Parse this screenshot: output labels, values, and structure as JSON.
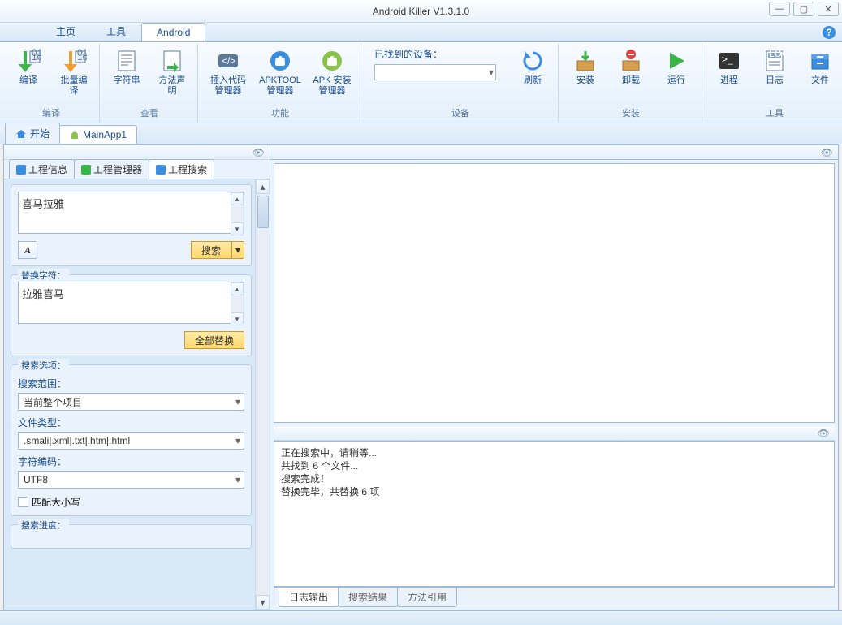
{
  "window": {
    "title": "Android Killer V1.3.1.0"
  },
  "menutabs": {
    "items": [
      "主页",
      "工具",
      "Android"
    ],
    "active": 2
  },
  "ribbon": {
    "groups": [
      {
        "label": "编译",
        "buttons": [
          {
            "name": "compile",
            "label": "编译",
            "icon": "arrow-down-binary",
            "color": "#3bb54a"
          },
          {
            "name": "batch-compile",
            "label": "批量编\n译",
            "icon": "arrow-down-binary",
            "color": "#f0a030"
          }
        ]
      },
      {
        "label": "查看",
        "buttons": [
          {
            "name": "strings",
            "label": "字符串",
            "icon": "page-lines",
            "color": "#5a7a9c"
          },
          {
            "name": "method-decl",
            "label": "方法声\n明",
            "icon": "page-arrow",
            "color": "#3bb54a"
          }
        ]
      },
      {
        "label": "功能",
        "buttons": [
          {
            "name": "insert-code",
            "label": "插入代码\n管理器",
            "icon": "code-brackets",
            "color": "#5a7a9c"
          },
          {
            "name": "apktool",
            "label": "APKTOOL\n管理器",
            "icon": "android-head",
            "color": "#3b8de0"
          },
          {
            "name": "apk-install",
            "label": "APK 安装\n管理器",
            "icon": "android-head",
            "color": "#8bc34a"
          }
        ]
      },
      {
        "label": "设备",
        "device_label": "已找到的设备：",
        "buttons": [
          {
            "name": "refresh",
            "label": "刷新",
            "icon": "refresh",
            "color": "#3b8de0"
          }
        ]
      },
      {
        "label": "安装",
        "buttons": [
          {
            "name": "install",
            "label": "安装",
            "icon": "box-down",
            "color": "#f0a030"
          },
          {
            "name": "uninstall",
            "label": "卸载",
            "icon": "box-up",
            "color": "#f0a030"
          },
          {
            "name": "run",
            "label": "运行",
            "icon": "play",
            "color": "#3bb54a"
          }
        ]
      },
      {
        "label": "工具",
        "buttons": [
          {
            "name": "process",
            "label": "进程",
            "icon": "terminal",
            "color": "#444"
          },
          {
            "name": "log",
            "label": "日志",
            "icon": "log-page",
            "color": "#5a7a9c"
          },
          {
            "name": "files",
            "label": "文件",
            "icon": "drawer",
            "color": "#3b8de0"
          }
        ]
      }
    ]
  },
  "doctabs": {
    "items": [
      {
        "name": "start",
        "label": "开始",
        "icon": "home"
      },
      {
        "name": "mainapp1",
        "label": "MainApp1",
        "icon": "android"
      }
    ],
    "active": 1
  },
  "left": {
    "tabs": {
      "items": [
        {
          "name": "project-info",
          "label": "工程信息",
          "color": "#3b8de0"
        },
        {
          "name": "project-manager",
          "label": "工程管理器",
          "color": "#3bb54a"
        },
        {
          "name": "project-search",
          "label": "工程搜索",
          "color": "#3b8de0"
        }
      ],
      "active": 2
    },
    "search": {
      "value": "喜马拉雅",
      "font_btn": "A",
      "search_btn": "搜索"
    },
    "replace": {
      "legend": "替换字符：",
      "value": "拉雅喜马",
      "replace_all_btn": "全部替换"
    },
    "options": {
      "legend": "搜索选项：",
      "scope_label": "搜索范围：",
      "scope_value": "当前整个项目",
      "filetype_label": "文件类型：",
      "filetype_value": ".smali|.xml|.txt|.htm|.html",
      "encoding_label": "字符编码：",
      "encoding_value": "UTF8",
      "match_case_label": "匹配大小写",
      "match_case_checked": false
    },
    "progress": {
      "legend": "搜索进度："
    }
  },
  "log": {
    "lines": "正在搜索中，请稍等...\n共找到 6 个文件...\n搜索完成！\n替换完毕，共替换 6 项"
  },
  "bottomtabs": {
    "items": [
      "日志输出",
      "搜索结果",
      "方法引用"
    ],
    "active": 0
  }
}
